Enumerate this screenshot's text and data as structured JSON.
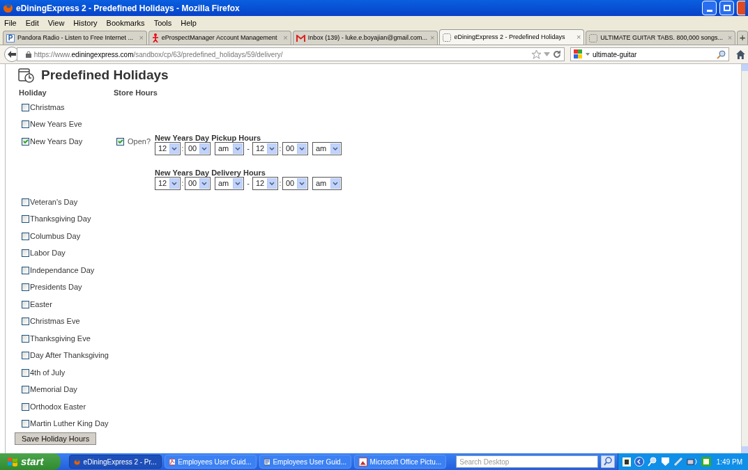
{
  "window": {
    "title": "eDiningExpress 2 - Predefined Holidays - Mozilla Firefox"
  },
  "menu": [
    "File",
    "Edit",
    "View",
    "History",
    "Bookmarks",
    "Tools",
    "Help"
  ],
  "tabs": [
    {
      "label": "Pandora Radio - Listen to Free Internet ...",
      "selected": false,
      "kind": "letter",
      "badge": "P",
      "close": "×"
    },
    {
      "label": "eProspectManager Account Management",
      "selected": false,
      "kind": "figure",
      "close": "×"
    },
    {
      "label": "Inbox (139) - luke.e.boyajian@gmail.com...",
      "selected": false,
      "kind": "mail",
      "close": "×"
    },
    {
      "label": "eDiningExpress 2 - Predefined Holidays",
      "selected": true,
      "kind": "blank",
      "close": "×"
    },
    {
      "label": "ULTIMATE GUITAR TABS. 800,000 songs...",
      "selected": false,
      "kind": "blank",
      "close": "×"
    }
  ],
  "new_tab": "+",
  "url": {
    "scheme": "https://www.",
    "host": "ediningexpress.com",
    "path": "/sandbox/cp/63/predefined_holidays/59/delivery/"
  },
  "search": {
    "value": "ultimate-guitar"
  },
  "page": {
    "title": "Predefined Holidays",
    "columns": [
      "Holiday",
      "Store Hours"
    ],
    "holidays": [
      {
        "label": "Christmas",
        "checked": false
      },
      {
        "label": "New Years Eve",
        "checked": false
      },
      {
        "label": "New Years Day",
        "checked": true,
        "open": {
          "label": "Open?",
          "checked": true
        },
        "schedules": [
          {
            "title": "New Years Day Pickup Hours",
            "from": [
              "12",
              "00",
              "am"
            ],
            "to": [
              "12",
              "00",
              "am"
            ]
          },
          {
            "title": "New Years Day Delivery Hours",
            "from": [
              "12",
              "00",
              "am"
            ],
            "to": [
              "12",
              "00",
              "am"
            ]
          }
        ]
      },
      {
        "label": "Veteran's Day",
        "checked": false
      },
      {
        "label": "Thanksgiving Day",
        "checked": false
      },
      {
        "label": "Columbus Day",
        "checked": false
      },
      {
        "label": "Labor Day",
        "checked": false
      },
      {
        "label": "Independance Day",
        "checked": false
      },
      {
        "label": "Presidents Day",
        "checked": false
      },
      {
        "label": "Easter",
        "checked": false
      },
      {
        "label": "Christmas Eve",
        "checked": false
      },
      {
        "label": "Thanksgiving Eve",
        "checked": false
      },
      {
        "label": "Day After Thanksgiving",
        "checked": false
      },
      {
        "label": "4th of July",
        "checked": false
      },
      {
        "label": "Memorial Day",
        "checked": false
      },
      {
        "label": "Orthodox Easter",
        "checked": false
      },
      {
        "label": "Martin Luther King Day",
        "checked": false
      }
    ],
    "time_separator": ":",
    "range_separator": "-",
    "save_button": "Save Holiday Hours"
  },
  "taskbar": {
    "start": "start",
    "tasks": [
      {
        "label": "eDiningExpress 2 - Pr...",
        "selected": true,
        "kind": "browser"
      },
      {
        "label": "Employees User Guid...",
        "selected": false,
        "kind": "pdf"
      },
      {
        "label": "Employees User Guid...",
        "selected": false,
        "kind": "doc"
      },
      {
        "label": "Microsoft Office Pictu...",
        "selected": false,
        "kind": "picture"
      }
    ],
    "search_placeholder": "Search Desktop",
    "clock": "1:49 PM"
  }
}
